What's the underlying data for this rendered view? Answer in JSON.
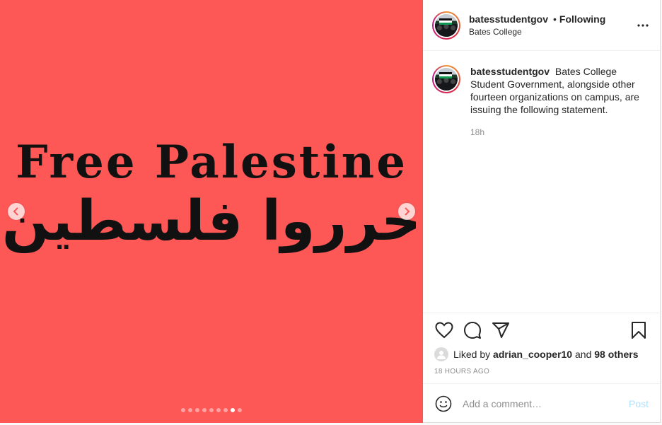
{
  "media": {
    "headline_en": "Free Palestine",
    "headline_ar": "حرروا فلسطين",
    "background_color": "#fd5756",
    "carousel": {
      "total": 9,
      "active_index": 7
    }
  },
  "header": {
    "username": "batesstudentgov",
    "separator": "•",
    "follow_status": "Following",
    "location": "Bates College"
  },
  "caption": {
    "username": "batesstudentgov",
    "text": "Bates College Student Government, alongside other fourteen organizations on campus, are issuing the following statement.",
    "time": "18h"
  },
  "likes": {
    "prefix": "Liked by",
    "liker": "adrian_cooper10",
    "connector": "and",
    "others": "98 others"
  },
  "post_time": "18 HOURS AGO",
  "comment": {
    "placeholder": "Add a comment…",
    "post_label": "Post"
  },
  "icons": [
    "chevron-left-icon",
    "chevron-right-icon",
    "more-icon",
    "heart-icon",
    "comment-icon",
    "share-icon",
    "bookmark-icon",
    "emoji-icon"
  ]
}
